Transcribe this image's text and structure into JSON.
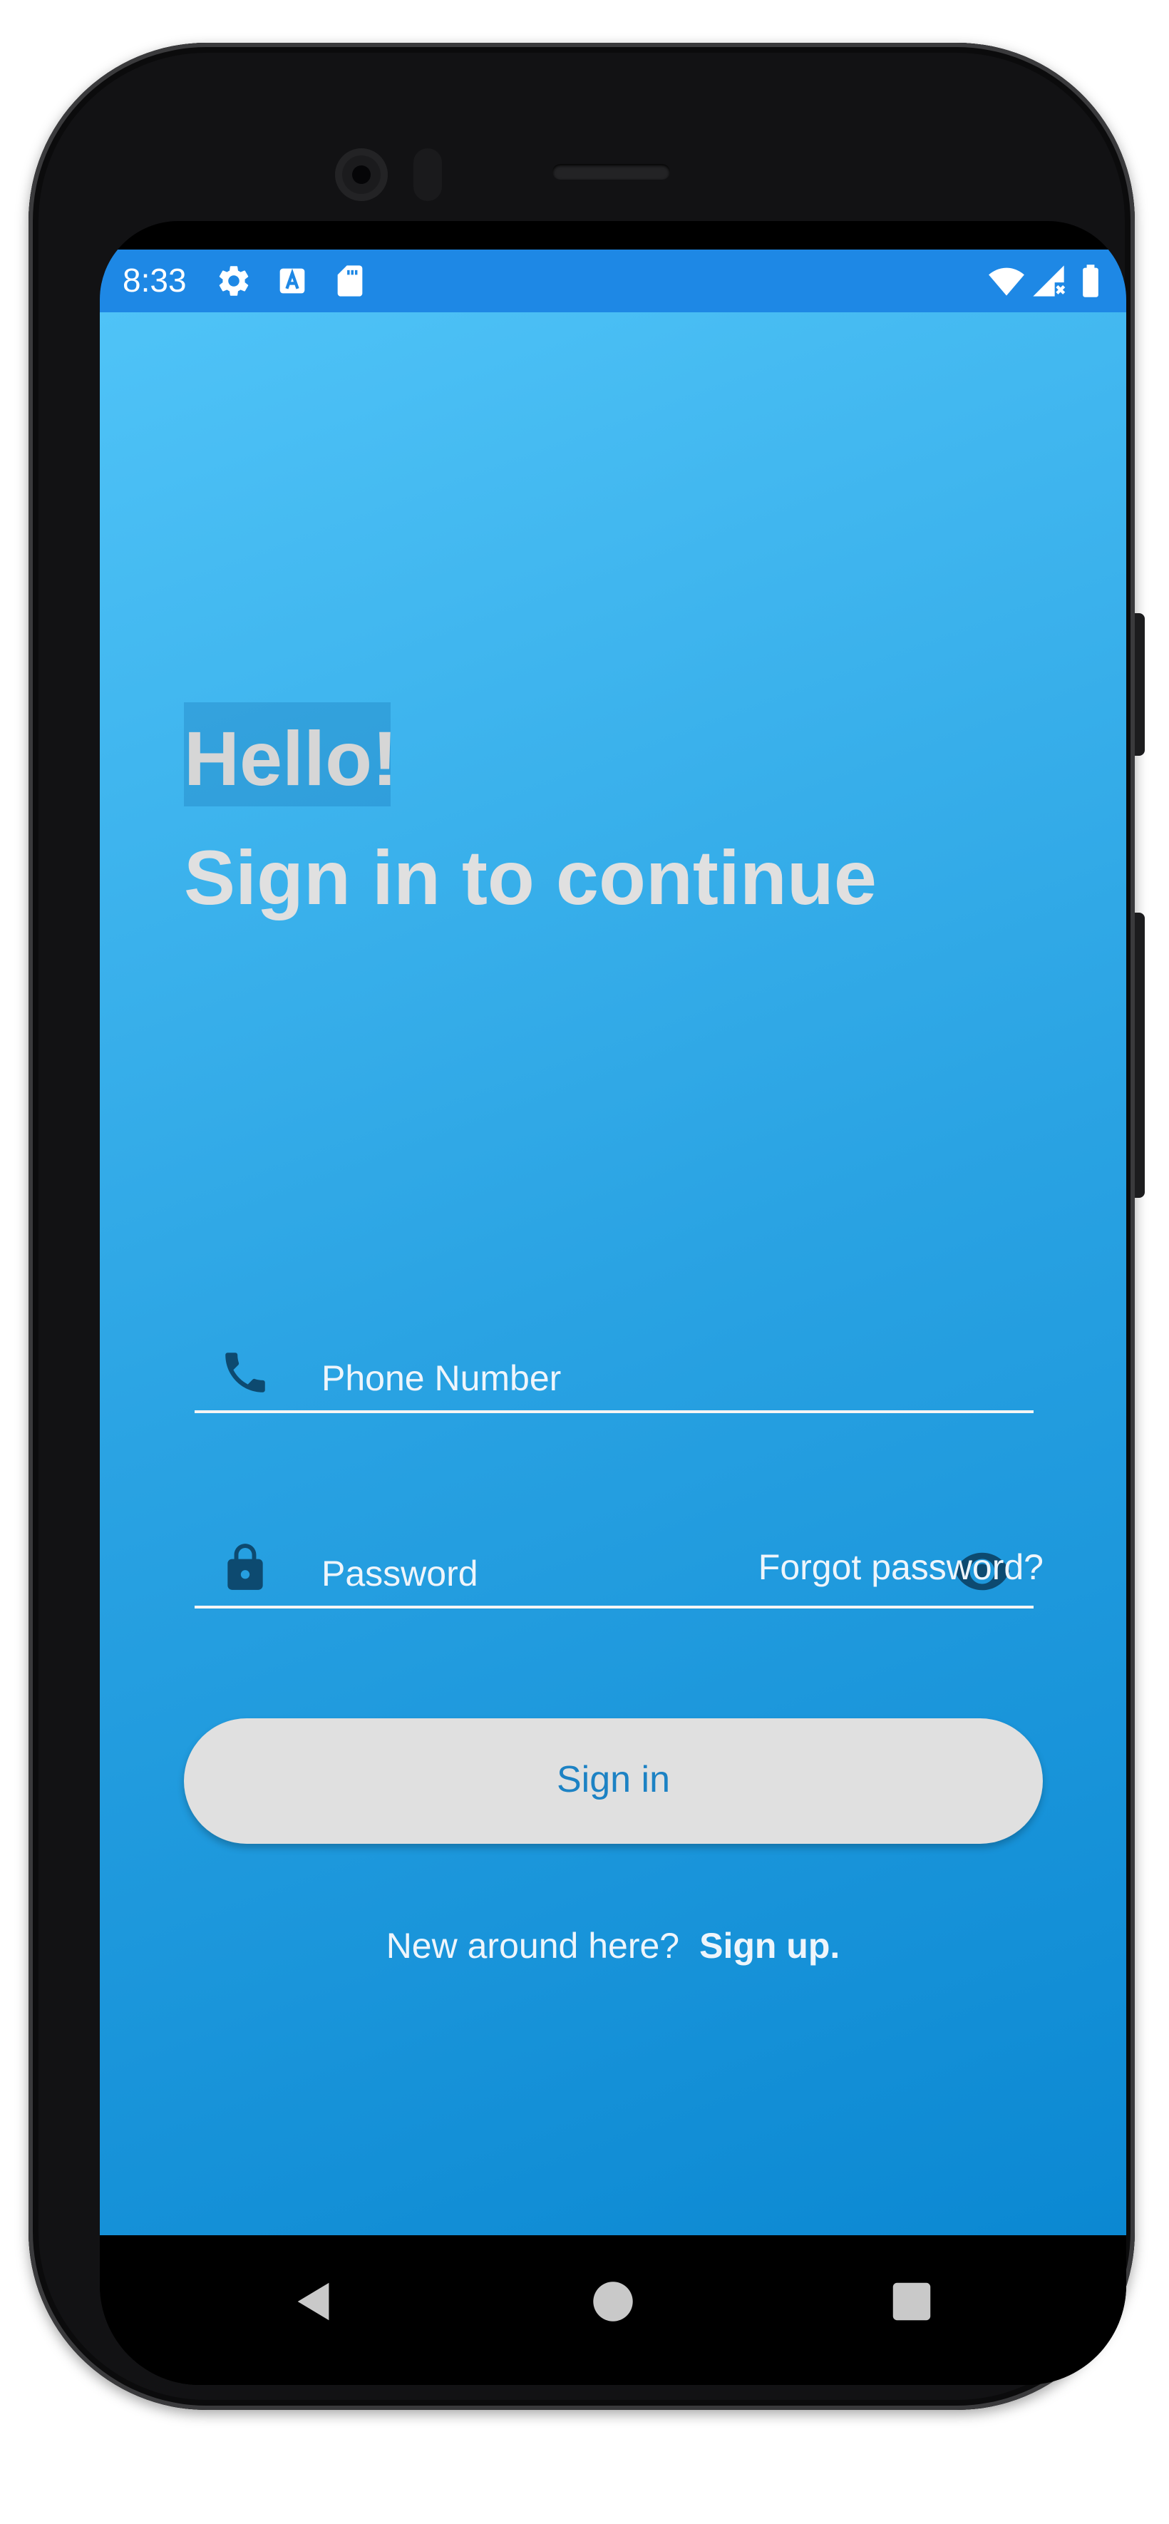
{
  "status_bar": {
    "time": "8:33",
    "left_icons": [
      "gear-icon",
      "a-notification-icon",
      "sd-card-icon"
    ],
    "right_icons": [
      "wifi-icon",
      "no-signal-icon",
      "battery-icon"
    ]
  },
  "login": {
    "greeting": "Hello!",
    "subtitle": "Sign in to continue",
    "phone_field": {
      "placeholder": "Phone Number",
      "icon": "phone-icon"
    },
    "password_field": {
      "placeholder": "Password",
      "icon": "lock-icon",
      "toggle_icon": "eye-icon"
    },
    "forgot_password": "Forgot password?",
    "sign_in_button": "Sign in",
    "signup_prompt": "New around here?",
    "signup_link": "Sign up."
  },
  "nav_bar": {
    "buttons": [
      "back-triangle-icon",
      "home-circle-icon",
      "recents-square-icon"
    ]
  },
  "colors": {
    "status_bar": "#1e88e5",
    "gradient_top": "#4fc3f7",
    "gradient_bottom": "#0b88d2",
    "button_bg": "#e0e0e0",
    "button_text": "#1c82c4",
    "icon_dark": "#0d4a70"
  }
}
